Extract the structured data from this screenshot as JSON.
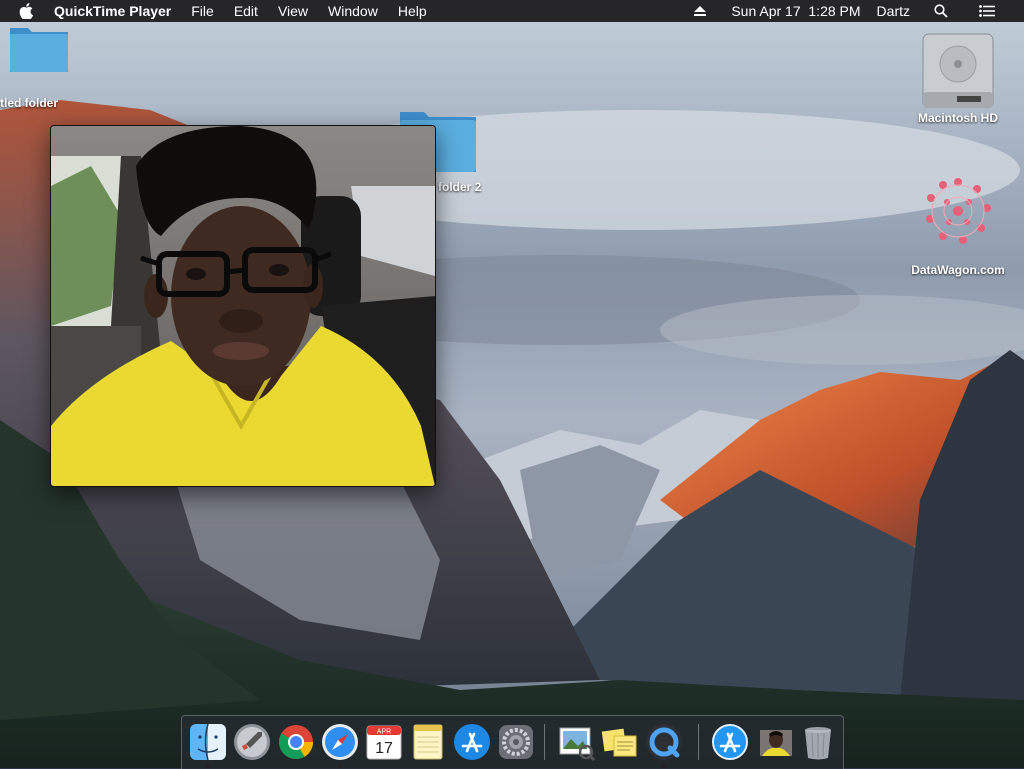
{
  "menubar": {
    "apple_icon": "apple-logo-icon",
    "app_name": "QuickTime Player",
    "menus": [
      "File",
      "Edit",
      "View",
      "Window",
      "Help"
    ],
    "datetime": "Sun Apr 17  1:28 PM",
    "user": "Dartz",
    "status_icons": [
      "eject-icon",
      "spotlight-search-icon",
      "notification-center-icon"
    ]
  },
  "desktop": {
    "icons": [
      {
        "name": "untitled-folder",
        "label": "tled folder",
        "icon": "folder-icon"
      },
      {
        "name": "folder-2",
        "label": "folder 2",
        "icon": "folder-icon"
      },
      {
        "name": "macintosh-hd",
        "label": "Macintosh HD",
        "icon": "hard-drive-icon"
      },
      {
        "name": "datawagon",
        "label": "DataWagon.com",
        "icon": "datawagon-logo-icon"
      }
    ]
  },
  "video_window": {
    "content": "front-camera-recording"
  },
  "dock": {
    "items": [
      {
        "name": "finder",
        "icon": "finder-icon",
        "running": true
      },
      {
        "name": "launchpad",
        "icon": "launchpad-rocket-icon",
        "running": false
      },
      {
        "name": "chrome",
        "icon": "chrome-icon",
        "running": false
      },
      {
        "name": "safari",
        "icon": "safari-compass-icon",
        "running": true
      },
      {
        "name": "calendar",
        "icon": "calendar-icon",
        "running": false,
        "month": "APR",
        "day": "17"
      },
      {
        "name": "notes",
        "icon": "notes-icon",
        "running": false
      },
      {
        "name": "app-store",
        "icon": "app-store-icon",
        "running": false
      },
      {
        "name": "system-preferences",
        "icon": "gear-icon",
        "running": false
      },
      {
        "name": "preview",
        "icon": "preview-icon",
        "running": false
      },
      {
        "name": "stickies",
        "icon": "stickies-icon",
        "running": false
      },
      {
        "name": "quicktime",
        "icon": "quicktime-icon",
        "running": true
      },
      {
        "name": "app-store-downloads",
        "icon": "app-store-icon",
        "running": false
      },
      {
        "name": "recording-thumbnail",
        "icon": "video-thumbnail-icon",
        "running": false
      },
      {
        "name": "trash",
        "icon": "trash-icon",
        "running": false
      }
    ]
  },
  "colors": {
    "menubar_bg": "#1c1c1e",
    "folder_blue": "#5aaee0",
    "shirt_yellow": "#e9d930"
  }
}
